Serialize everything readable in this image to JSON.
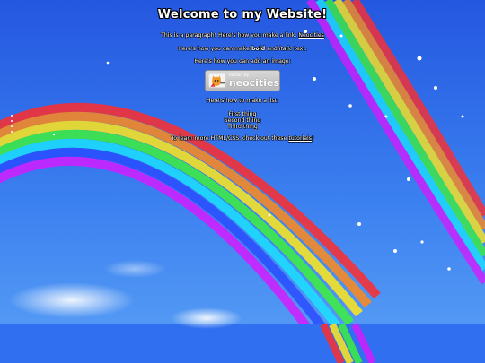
{
  "page": {
    "title": "Welcome to my Website!",
    "paragraph_prefix": "This is a paragraph! Here's how you make a link: ",
    "link_text": "Neocities",
    "bold_prefix": "Here's how you can make ",
    "bold_word": "bold",
    "bold_middle": " and ",
    "italic_word": "italic",
    "bold_suffix": " text.",
    "image_text": "Here's how you can add an image:",
    "list_intro": "Here's how to make a list:",
    "list_items": [
      "First thing",
      "Second thing",
      "Third thing"
    ],
    "learn_prefix": "To learn more HTML/CSS, check out these ",
    "tutorials_link": "tutorials",
    "learn_suffix": "!"
  },
  "badge": {
    "small_text": "hosted by",
    "brand_text": "neocities",
    "icon": "neocities-cat-logo"
  },
  "colors": {
    "background": "#3a7cf0",
    "text": "#ffffff"
  }
}
